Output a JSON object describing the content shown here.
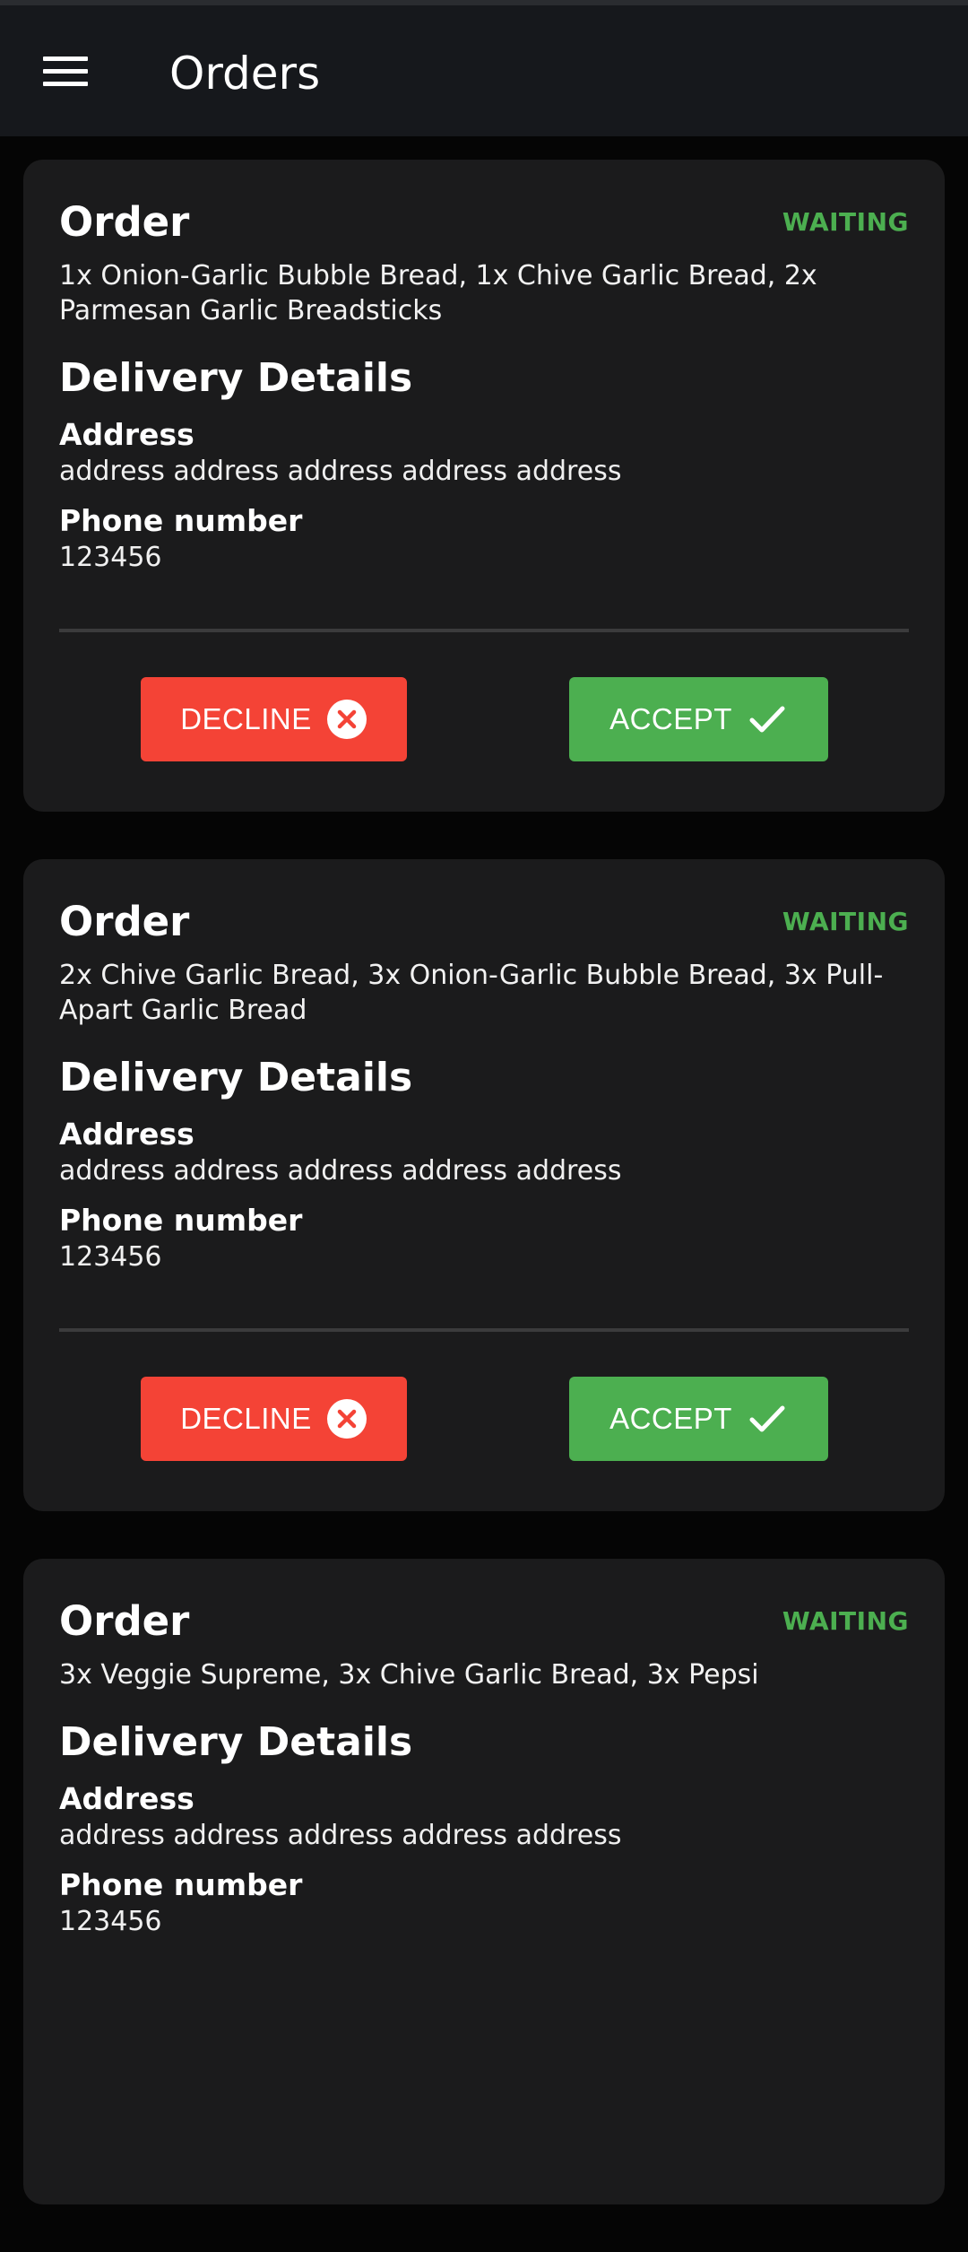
{
  "app": {
    "title": "Orders",
    "menu_icon": "hamburger-menu-icon"
  },
  "orders": [
    {
      "title": "Order",
      "status": "WAITING",
      "items": "1x Onion-Garlic Bubble Bread,  1x  Chive Garlic Bread,  2x Parmesan Garlic Breadsticks",
      "delivery_heading": "Delivery Details",
      "address_label": "Address",
      "address": "address address address address address",
      "phone_label": "Phone number",
      "phone": "123456",
      "decline_label": "DECLINE",
      "accept_label": "ACCEPT"
    },
    {
      "title": "Order",
      "status": "WAITING",
      "items": "2x Chive Garlic Bread,  3x  Onion-Garlic Bubble Bread,  3x Pull-Apart Garlic Bread",
      "delivery_heading": "Delivery Details",
      "address_label": "Address",
      "address": "address address address address address",
      "phone_label": "Phone number",
      "phone": "123456",
      "decline_label": "DECLINE",
      "accept_label": "ACCEPT"
    },
    {
      "title": "Order",
      "status": "WAITING",
      "items": "3x Veggie Supreme,  3x  Chive Garlic Bread,  3x Pepsi",
      "delivery_heading": "Delivery Details",
      "address_label": "Address",
      "address": "address address address address address",
      "phone_label": "Phone number",
      "phone": "123456"
    }
  ],
  "colors": {
    "background": "#050505",
    "appbar": "#16181c",
    "card": "#1b1b1c",
    "status_waiting": "#4caf50",
    "decline": "#f44336",
    "accept": "#4caf50"
  },
  "icons": {
    "decline": "cancel-circle-icon",
    "accept": "checkmark-icon"
  }
}
